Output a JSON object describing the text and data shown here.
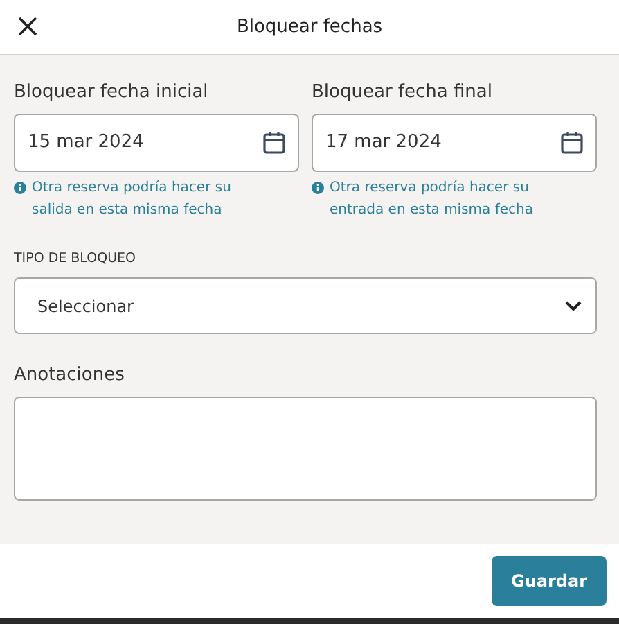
{
  "header": {
    "title": "Bloquear fechas"
  },
  "date_fields": [
    {
      "label": "Bloquear fecha inicial",
      "value": "15 mar 2024",
      "hint": "Otra reserva podría hacer su salida en esta misma fecha"
    },
    {
      "label": "Bloquear fecha final",
      "value": "17 mar 2024",
      "hint": "Otra reserva podría hacer su entrada en esta misma fecha"
    }
  ],
  "block_type": {
    "label": "TIPO DE BLOQUEO",
    "value": "Seleccionar"
  },
  "notes": {
    "label": "Anotaciones"
  },
  "footer": {
    "save_button": "Guardar"
  }
}
